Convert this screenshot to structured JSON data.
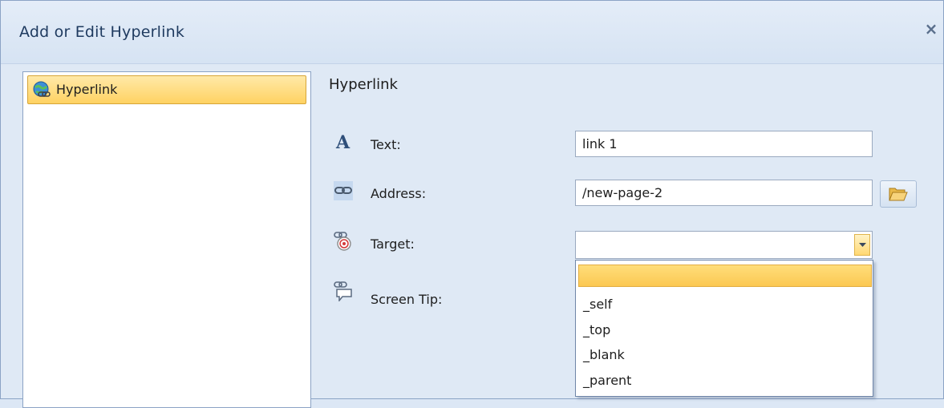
{
  "dialog": {
    "title": "Add or Edit Hyperlink",
    "close_glyph": "×"
  },
  "tree": {
    "items": [
      {
        "label": "Hyperlink",
        "icon": "globe-link-icon",
        "selected": true
      }
    ]
  },
  "form": {
    "section_title": "Hyperlink",
    "text_label": "Text:",
    "text_value": "link 1",
    "address_label": "Address:",
    "address_value": "/new-page-2",
    "target_label": "Target:",
    "target_value": "",
    "screentip_label": "Screen Tip:"
  },
  "target_dropdown": {
    "options": [
      "",
      "_self",
      "_top",
      "_blank",
      "_parent"
    ],
    "highlighted_index": 0
  },
  "colors": {
    "dialog_bg": "#dfe9f5",
    "selection": "#ffd262",
    "border": "#8ba3c5"
  }
}
